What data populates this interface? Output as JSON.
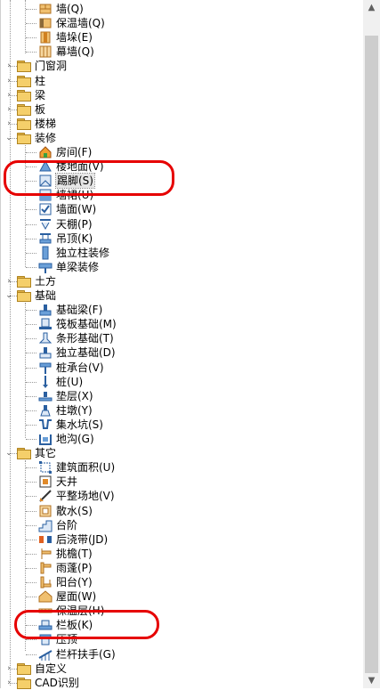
{
  "tree": {
    "items": [
      {
        "key": "wall",
        "label": "墙(Q)",
        "kind": "leaf",
        "icon": "wall-icon"
      },
      {
        "key": "insulation_wall",
        "label": "保温墙(Q)",
        "kind": "leaf",
        "icon": "insulation-wall-icon"
      },
      {
        "key": "wall_pier",
        "label": "墙垛(E)",
        "kind": "leaf",
        "icon": "wall-pier-icon"
      },
      {
        "key": "curtain_wall",
        "label": "幕墙(Q)",
        "kind": "leaf",
        "icon": "curtain-wall-icon"
      },
      {
        "key": "doors_windows",
        "label": "门窗洞",
        "kind": "folder",
        "state": "collapsed"
      },
      {
        "key": "column",
        "label": "柱",
        "kind": "folder",
        "state": "collapsed"
      },
      {
        "key": "beam",
        "label": "梁",
        "kind": "folder",
        "state": "collapsed"
      },
      {
        "key": "slab",
        "label": "板",
        "kind": "folder",
        "state": "collapsed"
      },
      {
        "key": "stairs",
        "label": "楼梯",
        "kind": "folder",
        "state": "collapsed"
      },
      {
        "key": "decoration",
        "label": "装修",
        "kind": "folder",
        "state": "expanded"
      },
      {
        "key": "room",
        "label": "房间(F)",
        "kind": "leaf",
        "icon": "room-icon"
      },
      {
        "key": "floor_surface",
        "label": "楼地面(V)",
        "kind": "leaf",
        "icon": "floor-icon"
      },
      {
        "key": "skirting",
        "label": "踢脚(S)",
        "kind": "leaf",
        "icon": "skirting-icon",
        "selected": true
      },
      {
        "key": "wall_skirt",
        "label": "墙裙(U)",
        "kind": "leaf",
        "icon": "wall-skirt-icon"
      },
      {
        "key": "wall_surface",
        "label": "墙面(W)",
        "kind": "leaf",
        "icon": "wall-surface-icon"
      },
      {
        "key": "ceiling",
        "label": "天棚(P)",
        "kind": "leaf",
        "icon": "ceiling-icon"
      },
      {
        "key": "suspended_ceiling",
        "label": "吊顶(K)",
        "kind": "leaf",
        "icon": "suspended-ceiling-icon"
      },
      {
        "key": "column_finish",
        "label": "独立柱装修",
        "kind": "leaf",
        "icon": "column-finish-icon"
      },
      {
        "key": "beam_finish",
        "label": "单梁装修",
        "kind": "leaf",
        "icon": "beam-finish-icon"
      },
      {
        "key": "earthwork",
        "label": "土方",
        "kind": "folder",
        "state": "collapsed"
      },
      {
        "key": "foundation",
        "label": "基础",
        "kind": "folder",
        "state": "expanded"
      },
      {
        "key": "foundation_beam",
        "label": "基础梁(F)",
        "kind": "leaf",
        "icon": "foundation-beam-icon"
      },
      {
        "key": "raft_foundation",
        "label": "筏板基础(M)",
        "kind": "leaf",
        "icon": "raft-foundation-icon"
      },
      {
        "key": "strip_foundation",
        "label": "条形基础(T)",
        "kind": "leaf",
        "icon": "strip-foundation-icon"
      },
      {
        "key": "isolated_foundation",
        "label": "独立基础(D)",
        "kind": "leaf",
        "icon": "isolated-foundation-icon"
      },
      {
        "key": "pile_cap",
        "label": "桩承台(V)",
        "kind": "leaf",
        "icon": "pile-cap-icon"
      },
      {
        "key": "pile",
        "label": "桩(U)",
        "kind": "leaf",
        "icon": "pile-icon"
      },
      {
        "key": "cushion",
        "label": "垫层(X)",
        "kind": "leaf",
        "icon": "cushion-icon"
      },
      {
        "key": "column_pier",
        "label": "柱墩(Y)",
        "kind": "leaf",
        "icon": "column-pier-icon"
      },
      {
        "key": "sump",
        "label": "集水坑(S)",
        "kind": "leaf",
        "icon": "sump-icon"
      },
      {
        "key": "trench",
        "label": "地沟(G)",
        "kind": "leaf",
        "icon": "trench-icon"
      },
      {
        "key": "other",
        "label": "其它",
        "kind": "folder",
        "state": "expanded"
      },
      {
        "key": "building_area",
        "label": "建筑面积(U)",
        "kind": "leaf",
        "icon": "building-area-icon"
      },
      {
        "key": "patio",
        "label": "天井",
        "kind": "leaf",
        "icon": "patio-icon"
      },
      {
        "key": "site_leveling",
        "label": "平整场地(V)",
        "kind": "leaf",
        "icon": "site-leveling-icon"
      },
      {
        "key": "apron",
        "label": "散水(S)",
        "kind": "leaf",
        "icon": "apron-icon"
      },
      {
        "key": "steps",
        "label": "台阶",
        "kind": "leaf",
        "icon": "steps-icon"
      },
      {
        "key": "post_cast_strip",
        "label": "后浇带(JD)",
        "kind": "leaf",
        "icon": "post-cast-strip-icon"
      },
      {
        "key": "eaves",
        "label": "挑檐(T)",
        "kind": "leaf",
        "icon": "eaves-icon"
      },
      {
        "key": "canopy",
        "label": "雨蓬(P)",
        "kind": "leaf",
        "icon": "canopy-icon"
      },
      {
        "key": "balcony",
        "label": "阳台(Y)",
        "kind": "leaf",
        "icon": "balcony-icon"
      },
      {
        "key": "roof",
        "label": "屋面(W)",
        "kind": "leaf",
        "icon": "roof-icon"
      },
      {
        "key": "insulation_layer",
        "label": "保温层(H)",
        "kind": "leaf",
        "icon": "insulation-layer-icon"
      },
      {
        "key": "parapet",
        "label": "栏板(K)",
        "kind": "leaf",
        "icon": "parapet-icon"
      },
      {
        "key": "coping",
        "label": "压顶",
        "kind": "leaf",
        "icon": "coping-icon"
      },
      {
        "key": "railing",
        "label": "栏杆扶手(G)",
        "kind": "leaf",
        "icon": "railing-icon"
      },
      {
        "key": "custom",
        "label": "自定义",
        "kind": "folder",
        "state": "collapsed"
      },
      {
        "key": "cad_recognition",
        "label": "CAD识别",
        "kind": "folder",
        "state": "collapsed"
      }
    ]
  },
  "colors": {
    "folder_fill": "#f5cf6a",
    "folder_edge": "#b08420",
    "annotation": "#e60000",
    "scrollbar_track": "#f0f0f0",
    "scrollbar_thumb": "#cdcdcd"
  }
}
